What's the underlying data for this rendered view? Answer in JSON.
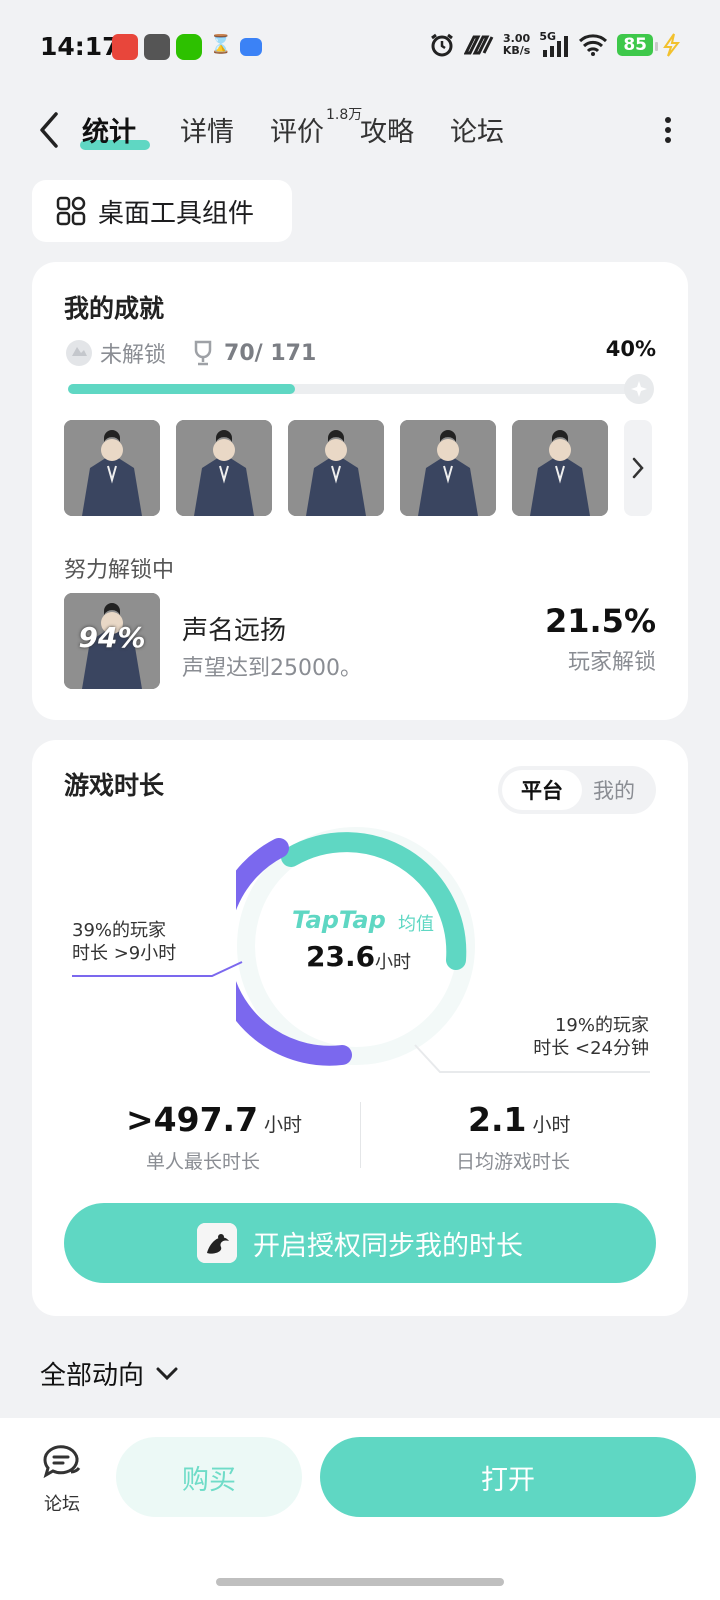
{
  "status_bar": {
    "time": "14:17",
    "net_speed_value": "3.00",
    "net_speed_unit": "KB/s",
    "network": "5G",
    "battery": "85"
  },
  "nav": {
    "tabs": [
      {
        "label": "统计"
      },
      {
        "label": "详情"
      },
      {
        "label": "评价"
      },
      {
        "label": "攻略"
      },
      {
        "label": "论坛"
      }
    ],
    "review_count": "1.8万"
  },
  "widget_chip": {
    "label": "桌面工具组件"
  },
  "achievements": {
    "title": "我的成就",
    "locked_label": "未解锁",
    "count": "70/ 171",
    "percent_text": "40%",
    "progress": 0.4,
    "in_progress_label": "努力解锁中",
    "current": {
      "progress_text": "94%",
      "name": "声名远扬",
      "desc": "声望达到25000。",
      "rate": "21.5%",
      "rate_label": "玩家解锁"
    }
  },
  "playtime": {
    "title": "游戏时长",
    "toggle": {
      "platform": "平台",
      "mine": "我的"
    },
    "avg_brand": "TapTap",
    "avg_brand_suffix": "均值",
    "avg_value": "23.6",
    "avg_unit": "小时",
    "callout_high_line1": "39%的玩家",
    "callout_high_line2": "时长 >9小时",
    "callout_low_line1": "19%的玩家",
    "callout_low_line2": "时长 <24分钟",
    "max_value": ">497.7",
    "max_unit": "小时",
    "max_label": "单人最长时长",
    "daily_value": "2.1",
    "daily_unit": "小时",
    "daily_label": "日均游戏时长",
    "sync_button": "开启授权同步我的时长"
  },
  "feed": {
    "filter_label": "全部动向"
  },
  "bottom_bar": {
    "forum_label": "论坛",
    "buy_label": "购买",
    "open_label": "打开"
  },
  "colors": {
    "accent": "#5fd7c3",
    "purple": "#7b68ee",
    "background": "#f1f2f4"
  }
}
